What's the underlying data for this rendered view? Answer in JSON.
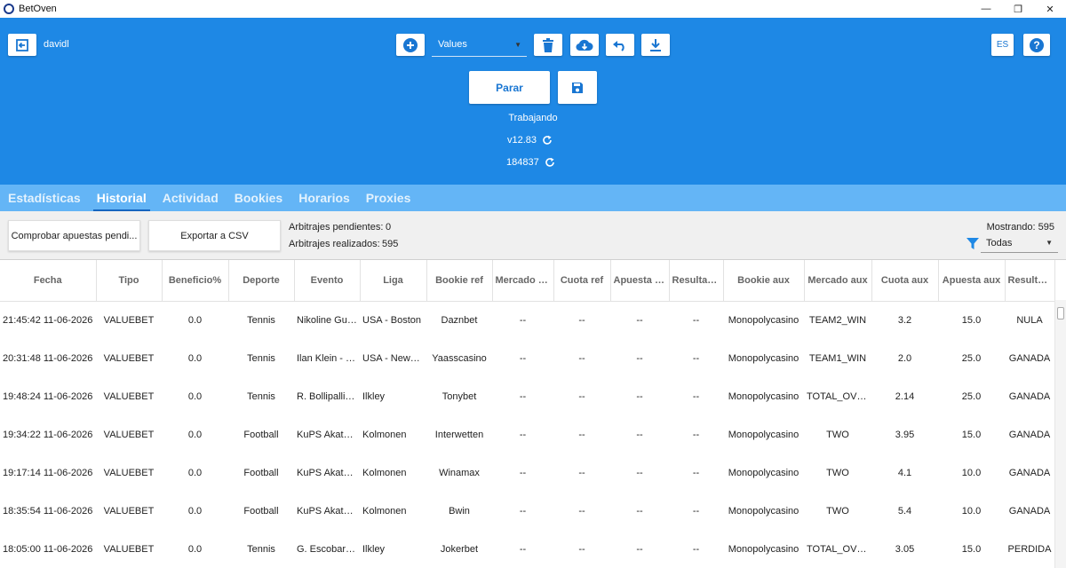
{
  "window": {
    "title": "BetOven",
    "minimize": "—",
    "maximize": "❐",
    "close": "✕"
  },
  "header": {
    "username": "davidl",
    "mode_select": "Values",
    "parar_label": "Parar",
    "status": "Trabajando",
    "version": "v12.83",
    "build": "184837",
    "language": "ES"
  },
  "tabs": [
    "Estadísticas",
    "Historial",
    "Actividad",
    "Bookies",
    "Horarios",
    "Proxies"
  ],
  "active_tab": "Historial",
  "toolbar": {
    "check_pending_label": "Comprobar apuestas pendi...",
    "export_csv_label": "Exportar a CSV",
    "pending_label": "Arbitrajes pendientes:",
    "pending_value": "0",
    "done_label": "Arbitrajes realizados:",
    "done_value": "595",
    "showing": "Mostrando: 595",
    "filter_value": "Todas"
  },
  "table": {
    "columns": [
      "Fecha",
      "Tipo",
      "Beneficio%",
      "Deporte",
      "Evento",
      "Liga",
      "Bookie ref",
      "Mercado ref",
      "Cuota ref",
      "Apuesta ref",
      "Resultad...",
      "Bookie aux",
      "Mercado aux",
      "Cuota aux",
      "Apuesta aux",
      "Resultad..."
    ],
    "rows": [
      [
        "21:45:42 11-06-2026",
        "VALUEBET",
        "0.0",
        "Tennis",
        "Nikoline Gulla...",
        "USA - Boston",
        "Daznbet",
        "--",
        "--",
        "--",
        "--",
        "Monopolycasino",
        "TEAM2_WIN",
        "3.2",
        "15.0",
        "NULA"
      ],
      [
        "20:31:48 11-06-2026",
        "VALUEBET",
        "0.0",
        "Tennis",
        "Ilan Klein - M...",
        "USA - Newpo...",
        "Yaasscasino",
        "--",
        "--",
        "--",
        "--",
        "Monopolycasino",
        "TEAM1_WIN",
        "2.0",
        "25.0",
        "GANADA"
      ],
      [
        "19:48:24 11-06-2026",
        "VALUEBET",
        "0.0",
        "Tennis",
        "R. Bollipalli/T. ...",
        "Ilkley",
        "Tonybet",
        "--",
        "--",
        "--",
        "--",
        "Monopolycasino",
        "TOTAL_OVER",
        "2.14",
        "25.0",
        "GANADA"
      ],
      [
        "19:34:22 11-06-2026",
        "VALUEBET",
        "0.0",
        "Football",
        "KuPS Akatemi...",
        "Kolmonen",
        "Interwetten",
        "--",
        "--",
        "--",
        "--",
        "Monopolycasino",
        "TWO",
        "3.95",
        "15.0",
        "GANADA"
      ],
      [
        "19:17:14 11-06-2026",
        "VALUEBET",
        "0.0",
        "Football",
        "KuPS Akatemi...",
        "Kolmonen",
        "Winamax",
        "--",
        "--",
        "--",
        "--",
        "Monopolycasino",
        "TWO",
        "4.1",
        "10.0",
        "GANADA"
      ],
      [
        "18:35:54 11-06-2026",
        "VALUEBET",
        "0.0",
        "Football",
        "KuPS Akatemi...",
        "Kolmonen",
        "Bwin",
        "--",
        "--",
        "--",
        "--",
        "Monopolycasino",
        "TWO",
        "5.4",
        "10.0",
        "GANADA"
      ],
      [
        "18:05:00 11-06-2026",
        "VALUEBET",
        "0.0",
        "Tennis",
        "G. Escobar/B. ...",
        "Ilkley",
        "Jokerbet",
        "--",
        "--",
        "--",
        "--",
        "Monopolycasino",
        "TOTAL_OVER",
        "3.05",
        "15.0",
        "PERDIDA"
      ]
    ]
  },
  "colors": {
    "header_blue": "#1e88e5",
    "tab_blue": "#64b5f6",
    "accent": "#1976d2"
  }
}
